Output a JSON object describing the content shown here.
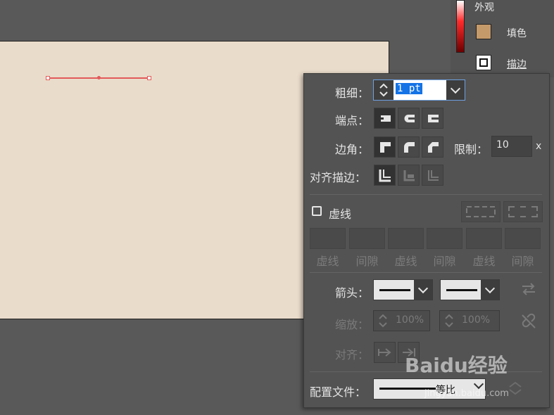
{
  "appearance": {
    "title": "外观",
    "fill_label": "填色",
    "stroke_label": "描边",
    "fill_color": "#c59a6a"
  },
  "stroke": {
    "weight_label": "粗细：",
    "weight_value": "1 pt",
    "cap_label": "端点：",
    "corner_label": "边角：",
    "limit_label": "限制：",
    "limit_value": "10",
    "limit_unit": "x",
    "align_label": "对齐描边：",
    "dashed_label": "虚线",
    "dash_labels": [
      "虚线",
      "间隙",
      "虚线",
      "间隙",
      "虚线",
      "间隙"
    ],
    "arrow_label": "箭头：",
    "scale_label": "缩放：",
    "scale_start": "100%",
    "scale_end": "100%",
    "align_arrow_label": "对齐：",
    "profile_label": "配置文件：",
    "profile_value": "等比"
  },
  "watermark": {
    "text": "Baidu经验",
    "sub": "jingyan.baidu.com"
  },
  "colors": {
    "artboard": "#eadccb",
    "path": "#e25a5a",
    "panel": "#535353",
    "selection": "#1473e6"
  }
}
